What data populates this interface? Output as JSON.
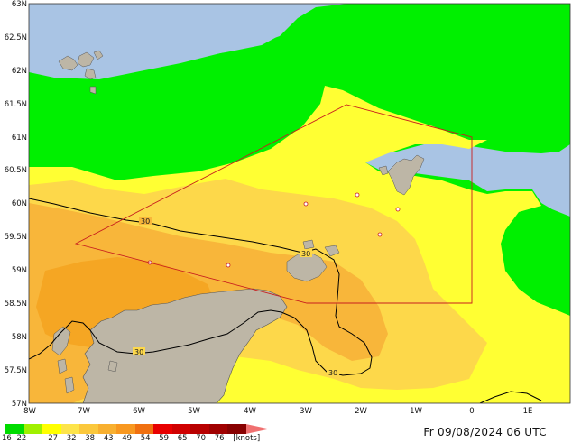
{
  "map": {
    "lat_labels": [
      "63N",
      "62.5N",
      "62N",
      "61.5N",
      "61N",
      "60.5N",
      "60N",
      "59.5N",
      "59N",
      "58.5N",
      "58N",
      "57.5N",
      "57N"
    ],
    "lon_labels": [
      "8W",
      "7W",
      "6W",
      "5W",
      "4W",
      "3W",
      "2W",
      "1W",
      "0",
      "1E"
    ],
    "contour_labels": [
      "30",
      "30",
      "30",
      "30"
    ],
    "colors": {
      "sea": "#a9c4e4",
      "land": "#bdb6a6",
      "green": "#00f000",
      "yellow": "#ffff33",
      "light_orange": "#fdd84a",
      "orange": "#f8b63a",
      "dark_orange": "#f5a623",
      "box": "#c81e1e",
      "contour": "#000000"
    }
  },
  "legend": {
    "colors": [
      "#00dc00",
      "#a0f000",
      "#ffff00",
      "#fde44a",
      "#fbc83c",
      "#f8b030",
      "#f89820",
      "#f07010",
      "#e80000",
      "#d00000",
      "#b80000",
      "#a00000",
      "#880000",
      "#f07070"
    ],
    "labels": [
      "16",
      "22",
      "27",
      "32",
      "38",
      "43",
      "49",
      "54",
      "59",
      "65",
      "70",
      "76",
      "[knots]"
    ]
  },
  "valid_time": "Fr 09/08/2024 06 UTC"
}
